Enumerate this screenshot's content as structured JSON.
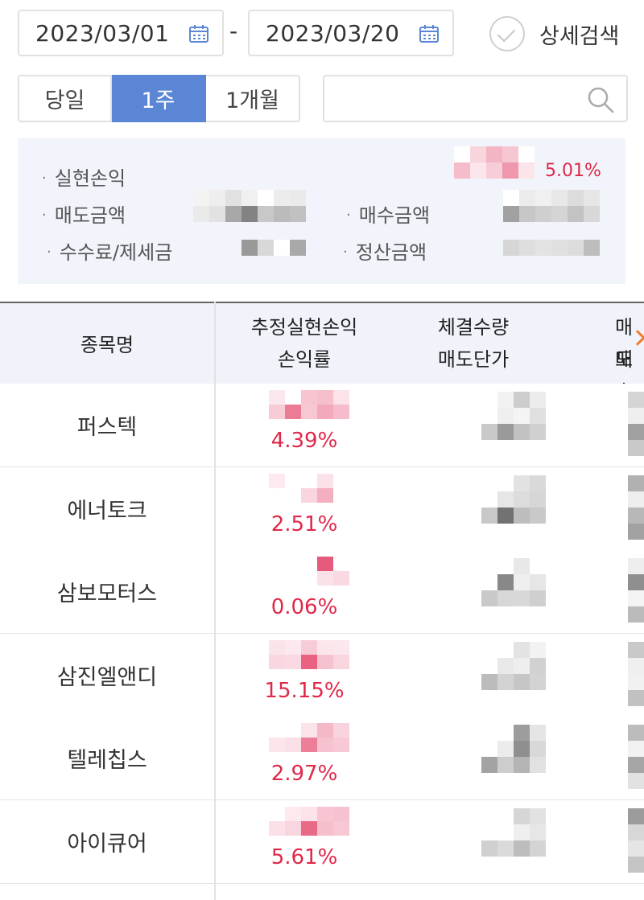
{
  "filters": {
    "start_date": "2023/03/01",
    "end_date": "2023/03/20",
    "separator": "-",
    "detail_search_label": "상세검색",
    "period_buttons": [
      {
        "label": "당일",
        "active": false
      },
      {
        "label": "1주",
        "active": true
      },
      {
        "label": "1개월",
        "active": false
      }
    ],
    "search_placeholder": ""
  },
  "summary": {
    "realized_pl_label": "실현손익",
    "realized_pl_rate": "5.01%",
    "sell_amount_label": "매도금액",
    "buy_amount_label": "매수금액",
    "fee_tax_label": "수수료/제세금",
    "settle_amount_label": "정산금액"
  },
  "table": {
    "col_name": "종목명",
    "col_est_pl": "추정실현손익",
    "col_pl_rate": "손익률",
    "col_qty": "체결수량",
    "col_sell_price": "매도단가",
    "col_next_top": "매도",
    "col_next_bottom": "매수",
    "rows": [
      {
        "name": "퍼스텍",
        "rate": "4.39%"
      },
      {
        "name": "에너토크",
        "rate": "2.51%"
      },
      {
        "name": "삼보모터스",
        "rate": "0.06%"
      },
      {
        "name": "삼진엘앤디",
        "rate": "15.15%"
      },
      {
        "name": "텔레칩스",
        "rate": "2.97%"
      },
      {
        "name": "아이큐어",
        "rate": "5.61%"
      }
    ]
  },
  "colors": {
    "accent_blue": "#5b86d6",
    "profit_red": "#e0284a",
    "scroll_arrow": "#f07c2c"
  },
  "icons": [
    "calendar-icon",
    "check-circle-icon",
    "search-icon",
    "chevron-right-icon"
  ]
}
